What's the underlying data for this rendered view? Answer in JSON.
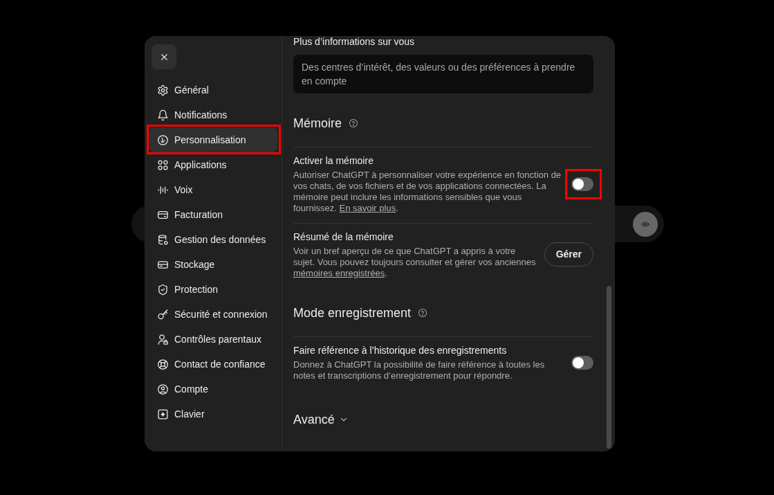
{
  "sidebar": {
    "items": [
      {
        "label": "Général",
        "selected": false,
        "highlighted": false
      },
      {
        "label": "Notifications",
        "selected": false,
        "highlighted": false
      },
      {
        "label": "Personnalisation",
        "selected": true,
        "highlighted": true
      },
      {
        "label": "Applications",
        "selected": false,
        "highlighted": false
      },
      {
        "label": "Voix",
        "selected": false,
        "highlighted": false
      },
      {
        "label": "Facturation",
        "selected": false,
        "highlighted": false
      },
      {
        "label": "Gestion des données",
        "selected": false,
        "highlighted": false
      },
      {
        "label": "Stockage",
        "selected": false,
        "highlighted": false
      },
      {
        "label": "Protection",
        "selected": false,
        "highlighted": false
      },
      {
        "label": "Sécurité et connexion",
        "selected": false,
        "highlighted": false
      },
      {
        "label": "Contrôles parentaux",
        "selected": false,
        "highlighted": false
      },
      {
        "label": "Contact de confiance",
        "selected": false,
        "highlighted": false
      },
      {
        "label": "Compte",
        "selected": false,
        "highlighted": false
      },
      {
        "label": "Clavier",
        "selected": false,
        "highlighted": false
      }
    ]
  },
  "content": {
    "about": {
      "label": "Plus d’informations sur vous",
      "placeholder": "Des centres d’intérêt, des valeurs ou des préférences à prendre en compte"
    },
    "sections": [
      {
        "title": "Mémoire",
        "settings": [
          {
            "kind": "toggle",
            "title": "Activer la mémoire",
            "description": "Autoriser ChatGPT à personnaliser votre expérience en fonction de vos chats, de vos fichiers et de vos applications connectées. La mémoire peut inclure les informations sensibles que vous fournissez.",
            "link": "En savoir plus",
            "link_suffix": ".",
            "on": false,
            "highlighted": true
          },
          {
            "kind": "button",
            "title": "Résumé de la mémoire",
            "description": "Voir un bref aperçu de ce que ChatGPT a appris à votre sujet. Vous pouvez toujours consulter et gérer vos anciennes",
            "link": "mémoires enregistrées",
            "link_suffix": ".",
            "button": "Gérer"
          }
        ]
      },
      {
        "title": "Mode enregistrement",
        "settings": [
          {
            "kind": "toggle",
            "title": "Faire référence à l’historique des enregistrements",
            "description": "Donnez à ChatGPT la possibilité de faire référence à toutes les notes et transcriptions d’enregistrement pour répondre.",
            "on": false,
            "highlighted": false
          }
        ]
      }
    ],
    "advanced": {
      "label": "Avancé",
      "expanded": false
    }
  }
}
